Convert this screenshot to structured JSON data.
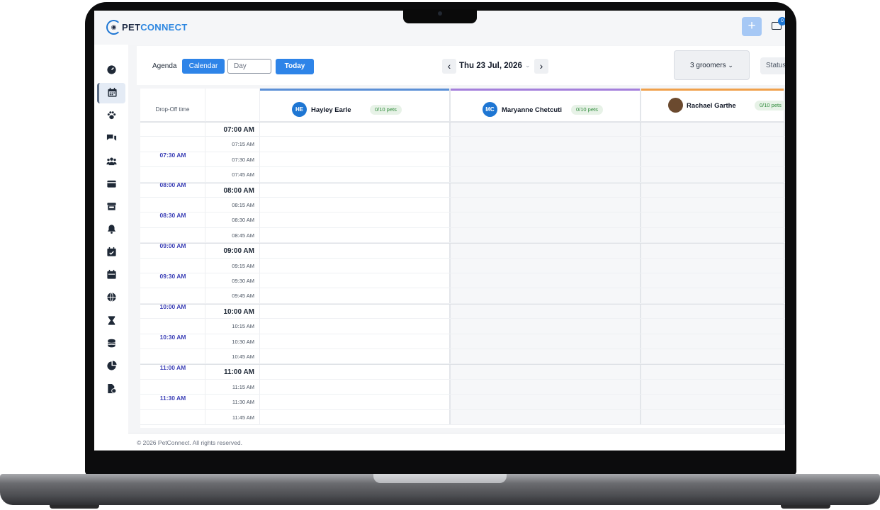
{
  "app": {
    "logo_prefix": "PET",
    "logo_suffix": "CONNECT",
    "add_label": "+",
    "mail_badge": "0",
    "brand_color": "#1e76d3"
  },
  "sidebar": {
    "items": [
      {
        "icon": "dashboard-icon",
        "active": false
      },
      {
        "icon": "calendar-icon",
        "active": true
      },
      {
        "icon": "paw-icon",
        "active": false
      },
      {
        "icon": "chat-icon",
        "active": false
      },
      {
        "icon": "users-icon",
        "active": false
      },
      {
        "icon": "wallet-icon",
        "active": false
      },
      {
        "icon": "store-icon",
        "active": false
      },
      {
        "icon": "bell-icon",
        "active": false
      },
      {
        "icon": "calendar-check-icon",
        "active": false
      },
      {
        "icon": "calendar-day-icon",
        "active": false
      },
      {
        "icon": "globe-icon",
        "active": false
      },
      {
        "icon": "hourglass-icon",
        "active": false
      },
      {
        "icon": "coins-icon",
        "active": false
      },
      {
        "icon": "pie-chart-icon",
        "active": false
      },
      {
        "icon": "file-settings-icon",
        "active": false
      }
    ]
  },
  "toolbar": {
    "agenda_label": "Agenda",
    "calendar_label": "Calendar",
    "view_select_value": "Day",
    "today_label": "Today",
    "date_label": "Thu 23 Jul, 2026",
    "groomers_label": "3 groomers",
    "status_label": "Status"
  },
  "calendar": {
    "dropoff_header": "Drop-Off time",
    "groomers": [
      {
        "initials": "HE",
        "name": "Hayley Earle",
        "badge": "0/10 pets",
        "bar_color": "#5b8fd6",
        "avatar_color": "#1e76d3"
      },
      {
        "initials": "MC",
        "name": "Maryanne Chetcuti",
        "badge": "0/10 pets",
        "bar_color": "#a47fdb",
        "avatar_color": "#1e76d3"
      },
      {
        "initials": "",
        "name": "Rachael Garthe",
        "badge": "0/10 pets",
        "bar_color": "#f0a04b",
        "avatar_color": "#6b4a2f"
      }
    ],
    "slots": [
      {
        "time": "07:00 AM",
        "hour": true
      },
      {
        "time": "07:15 AM",
        "hour": false
      },
      {
        "time": "07:30 AM",
        "hour": false
      },
      {
        "time": "07:45 AM",
        "hour": false
      },
      {
        "time": "08:00 AM",
        "hour": true
      },
      {
        "time": "08:15 AM",
        "hour": false
      },
      {
        "time": "08:30 AM",
        "hour": false
      },
      {
        "time": "08:45 AM",
        "hour": false
      },
      {
        "time": "09:00 AM",
        "hour": true
      },
      {
        "time": "09:15 AM",
        "hour": false
      },
      {
        "time": "09:30 AM",
        "hour": false
      },
      {
        "time": "09:45 AM",
        "hour": false
      },
      {
        "time": "10:00 AM",
        "hour": true
      },
      {
        "time": "10:15 AM",
        "hour": false
      },
      {
        "time": "10:30 AM",
        "hour": false
      },
      {
        "time": "10:45 AM",
        "hour": false
      },
      {
        "time": "11:00 AM",
        "hour": true
      },
      {
        "time": "11:15 AM",
        "hour": false
      },
      {
        "time": "11:30 AM",
        "hour": false
      },
      {
        "time": "11:45 AM",
        "hour": false
      }
    ],
    "dropoff_labels": [
      "07:30 AM",
      "08:00 AM",
      "08:30 AM",
      "09:00 AM",
      "09:30 AM",
      "10:00 AM",
      "10:30 AM",
      "11:00 AM",
      "11:30 AM"
    ]
  },
  "footer": {
    "copyright": "© 2026 PetConnect. All rights reserved."
  }
}
